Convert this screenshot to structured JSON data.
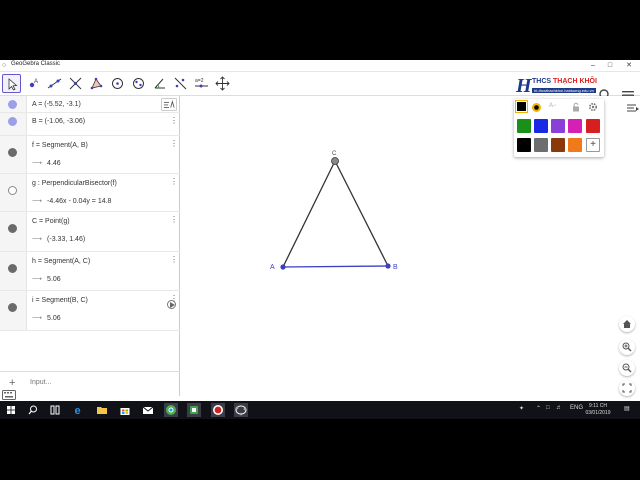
{
  "window": {
    "title": "GeoGebra Classic",
    "minimize_glyph": "–",
    "maximize_glyph": "□",
    "close_glyph": "✕"
  },
  "toolbar": {
    "tools": [
      {
        "name": "move-tool",
        "icon": "cursor-icon"
      },
      {
        "name": "point-tool",
        "icon": "point-icon"
      },
      {
        "name": "line-tool",
        "icon": "line-icon"
      },
      {
        "name": "perpendicular-line-tool",
        "icon": "perpendicular-icon"
      },
      {
        "name": "polygon-tool",
        "icon": "polygon-icon"
      },
      {
        "name": "circle-tool",
        "icon": "circle-icon"
      },
      {
        "name": "ellipse-tool",
        "icon": "ellipse-icon"
      },
      {
        "name": "angle-tool",
        "icon": "angle-icon"
      },
      {
        "name": "slider-tool",
        "icon": "slider-icon",
        "label": "a=2"
      },
      {
        "name": "move-graphics-tool",
        "icon": "move-arrows-icon"
      }
    ],
    "logo": {
      "mark": "H",
      "name_prefix": "THCS ",
      "name_highlight": "THẠCH KHÔI",
      "url": "ht-thcsthachkhoi.haiduong.edu.vn"
    }
  },
  "algebra": {
    "rows": [
      {
        "def": "A = (-5.52, -3.1)",
        "value": "",
        "marble_color": "#9b9fe8",
        "filled": true
      },
      {
        "def": "B = (-1.06, -3.06)",
        "value": "",
        "marble_color": "#9b9fe8",
        "filled": true
      },
      {
        "def": "f = Segment(A, B)",
        "value": "4.46",
        "marble_color": "#6b6b6b",
        "filled": true
      },
      {
        "def": "g : PerpendicularBisector(f)",
        "value": "-4.46x - 0.04y = 14.8",
        "marble_color": "#6b6b6b",
        "filled": false
      },
      {
        "def": "C = Point(g)",
        "value": "(-3.33, 1.46)",
        "marble_color": "#6b6b6b",
        "filled": true
      },
      {
        "def": "h = Segment(A, C)",
        "value": "5.06",
        "marble_color": "#6b6b6b",
        "filled": true
      },
      {
        "def": "i = Segment(B, C)",
        "value": "5.06",
        "marble_color": "#6b6b6b",
        "filled": true
      }
    ],
    "arrow_glyph": "⟶",
    "more_glyph": "⋮",
    "input_placeholder": "Input...",
    "input_plus": "+"
  },
  "graphics": {
    "points": [
      {
        "label": "A",
        "color": "#3c3fc0"
      },
      {
        "label": "B",
        "color": "#3c3fc0"
      },
      {
        "label": "C",
        "color": "#444444"
      }
    ],
    "segment_color": "#333333",
    "base_color": "#3c3fc0",
    "color_popup": {
      "top_label": "A−",
      "swatches": [
        "#1a8f1a",
        "#1a29e6",
        "#8a3fd6",
        "#d61fb5",
        "#d61f1f",
        "#000000",
        "#6e6e6e",
        "#8a3a0a",
        "#f07a1a"
      ],
      "add_label": "+"
    }
  },
  "taskbar": {
    "time": "9:11 CH",
    "date": "03/01/2019",
    "language": "ENG"
  }
}
